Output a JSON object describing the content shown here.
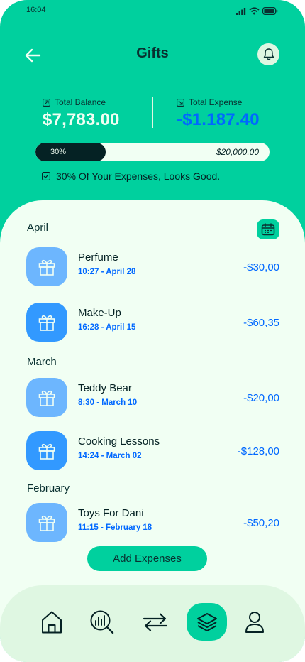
{
  "status_bar": {
    "time": "16:04"
  },
  "header": {
    "title": "Gifts"
  },
  "balance": {
    "total_balance_label": "Total Balance",
    "total_balance_value": "$7,783.00",
    "total_expense_label": "Total Expense",
    "total_expense_value": "-$1.187.40"
  },
  "progress": {
    "percent_label": "30%",
    "fraction": 0.3,
    "goal": "$20,000.00"
  },
  "status_message": "30% Of Your Expenses, Looks Good.",
  "months": [
    "April",
    "March",
    "February"
  ],
  "transactions": [
    {
      "name": "Perfume",
      "date": "10:27 - April 28",
      "amount": "-$30,00",
      "icon": "gift-icon"
    },
    {
      "name": "Make-Up",
      "date": "16:28 - April 15",
      "amount": "-$60,35",
      "icon": "gift-icon"
    },
    {
      "name": "Teddy Bear",
      "date": "8:30 - March 10",
      "amount": "-$20,00",
      "icon": "gift-icon"
    },
    {
      "name": "Cooking Lessons",
      "date": "14:24 - March 02",
      "amount": "-$128,00",
      "icon": "gift-icon"
    },
    {
      "name": "Toys For Dani",
      "date": "11:15 - February 18",
      "amount": "-$50,20",
      "icon": "gift-icon"
    }
  ],
  "add_button_label": "Add Expenses",
  "nav": [
    "home-icon",
    "analysis-icon",
    "transactions-icon",
    "categories-icon",
    "profile-icon"
  ],
  "colors": {
    "primary": "#00D09E",
    "background": "#F1FFF3",
    "expense": "#0068FF",
    "dark": "#052224"
  }
}
